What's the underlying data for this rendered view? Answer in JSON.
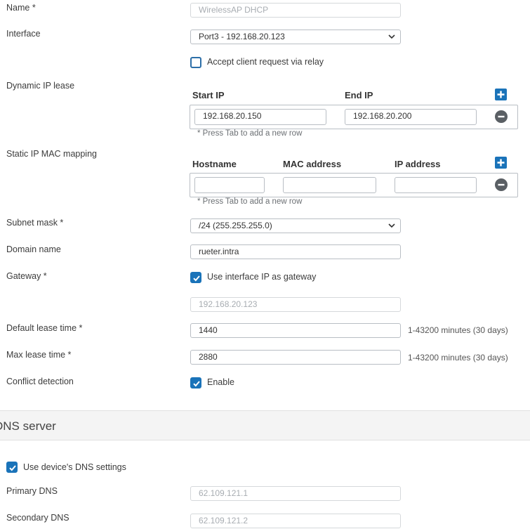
{
  "form": {
    "name": {
      "label": "Name *",
      "value": "WirelessAP DHCP"
    },
    "interface": {
      "label": "Interface",
      "value": "Port3 - 192.168.20.123"
    },
    "relay": {
      "label": "Accept client request via relay",
      "checked": false
    },
    "dynamic_ip_lease": {
      "label": "Dynamic IP lease",
      "columns": [
        "Start IP",
        "End IP"
      ],
      "rows": [
        {
          "start_ip": "192.168.20.150",
          "end_ip": "192.168.20.200"
        }
      ],
      "hint": "* Press Tab to add a new row"
    },
    "static_mapping": {
      "label": "Static IP MAC mapping",
      "columns": [
        "Hostname",
        "MAC address",
        "IP address"
      ],
      "rows": [
        {
          "hostname": "",
          "mac": "",
          "ip": ""
        }
      ],
      "hint": "* Press Tab to add a new row"
    },
    "subnet_mask": {
      "label": "Subnet mask *",
      "value": "/24 (255.255.255.0)"
    },
    "domain_name": {
      "label": "Domain name",
      "value": "rueter.intra"
    },
    "gateway": {
      "label": "Gateway *",
      "checkbox_label": "Use interface IP as gateway",
      "checked": true,
      "value": "192.168.20.123"
    },
    "default_lease": {
      "label": "Default lease time *",
      "value": "1440",
      "note": "1-43200 minutes (30 days)"
    },
    "max_lease": {
      "label": "Max lease time *",
      "value": "2880",
      "note": "1-43200 minutes (30 days)"
    },
    "conflict": {
      "label": "Conflict detection",
      "checkbox_label": "Enable",
      "checked": true
    }
  },
  "dns": {
    "section_title": "DNS server",
    "use_device": {
      "label": "Use device's DNS settings",
      "checked": true
    },
    "primary": {
      "label": "Primary DNS",
      "value": "62.109.121.1"
    },
    "secondary": {
      "label": "Secondary DNS",
      "value": "62.109.121.2"
    }
  },
  "colors": {
    "accent": "#1a73b9",
    "remove_button": "#5a5f64"
  },
  "icons": {
    "add_row": "plus-icon",
    "remove_row": "minus-icon",
    "dropdown": "chevron-down-icon",
    "checked": "checkmark-icon"
  }
}
